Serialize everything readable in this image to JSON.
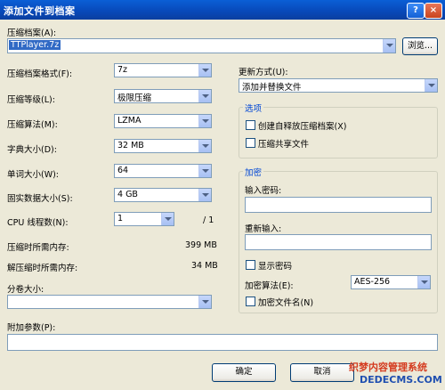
{
  "window": {
    "title": "添加文件到档案",
    "help_btn": "?",
    "close_btn": "×"
  },
  "archive": {
    "label": "压缩档案(A):",
    "value": "TTPlayer.7z",
    "browse": "浏览..."
  },
  "left": {
    "format": {
      "label": "压缩档案格式(F):",
      "value": "7z"
    },
    "level": {
      "label": "压缩等级(L):",
      "value": "极限压缩"
    },
    "method": {
      "label": "压缩算法(M):",
      "value": "LZMA"
    },
    "dict": {
      "label": "字典大小(D):",
      "value": "32 MB"
    },
    "word": {
      "label": "单词大小(W):",
      "value": "64"
    },
    "solid": {
      "label": "固实数据大小(S):",
      "value": "4 GB"
    },
    "threads": {
      "label": "CPU 线程数(N):",
      "value": "1",
      "suffix": "/ 1"
    },
    "mem_compress": {
      "label": "压缩时所需内存:",
      "value": "399 MB"
    },
    "mem_decompress": {
      "label": "解压缩时所需内存:",
      "value": "34 MB"
    },
    "split": {
      "label": "分卷大小:",
      "value": ""
    }
  },
  "right": {
    "update": {
      "label": "更新方式(U):",
      "value": "添加并替换文件"
    },
    "options": {
      "title": "选项",
      "sfx": "创建自释放压缩档案(X)",
      "shared": "压缩共享文件"
    },
    "encryption": {
      "title": "加密",
      "enter_pw": "输入密码:",
      "reenter_pw": "重新输入:",
      "show_pw": "显示密码",
      "method_label": "加密算法(E):",
      "method_value": "AES-256",
      "encrypt_names": "加密文件名(N)"
    }
  },
  "params": {
    "label": "附加参数(P):",
    "value": ""
  },
  "buttons": {
    "ok": "确定",
    "cancel": "取消"
  },
  "watermark": {
    "line1": "织梦内容管理系统",
    "line2": "DEDECMS.COM"
  }
}
